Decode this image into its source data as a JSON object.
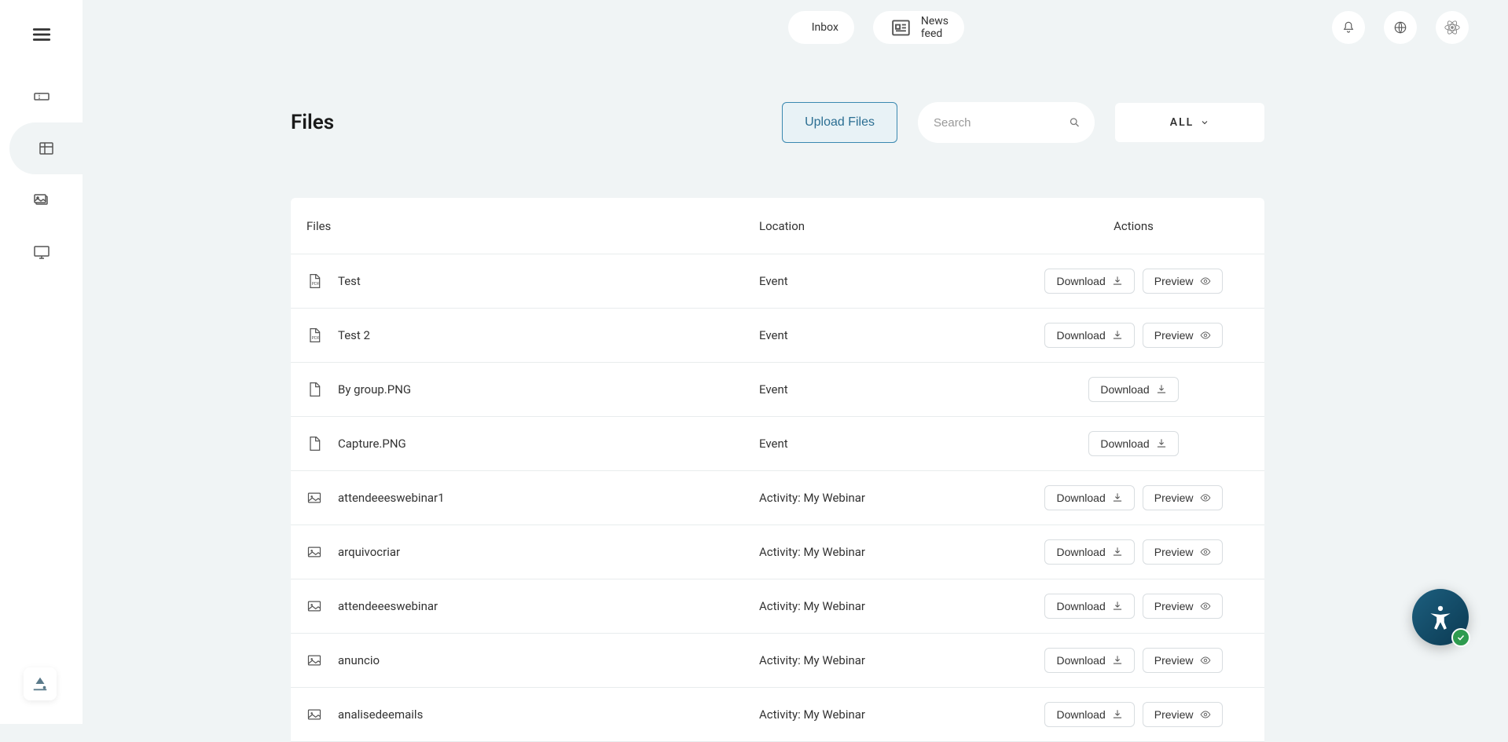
{
  "topbar": {
    "inbox_label": "Inbox",
    "news_label": "News feed"
  },
  "page": {
    "title": "Files"
  },
  "controls": {
    "upload_label": "Upload Files",
    "search_placeholder": "Search",
    "filter_label": "ALL"
  },
  "table": {
    "headers": {
      "files": "Files",
      "location": "Location",
      "actions": "Actions"
    },
    "download_label": "Download",
    "preview_label": "Preview",
    "rows": [
      {
        "icon": "pdf",
        "name": "Test",
        "location": "Event",
        "preview": true
      },
      {
        "icon": "pdf",
        "name": "Test 2",
        "location": "Event",
        "preview": true
      },
      {
        "icon": "file",
        "name": "By group.PNG",
        "location": "Event",
        "preview": false
      },
      {
        "icon": "file",
        "name": "Capture.PNG",
        "location": "Event",
        "preview": false
      },
      {
        "icon": "image",
        "name": "attendeeeswebinar1",
        "location": "Activity: My Webinar",
        "preview": true
      },
      {
        "icon": "image",
        "name": "arquivocriar",
        "location": "Activity: My Webinar",
        "preview": true
      },
      {
        "icon": "image",
        "name": "attendeeeswebinar",
        "location": "Activity: My Webinar",
        "preview": true
      },
      {
        "icon": "image",
        "name": "anuncio",
        "location": "Activity: My Webinar",
        "preview": true
      },
      {
        "icon": "image",
        "name": "analisedeemails",
        "location": "Activity: My Webinar",
        "preview": true
      }
    ]
  }
}
